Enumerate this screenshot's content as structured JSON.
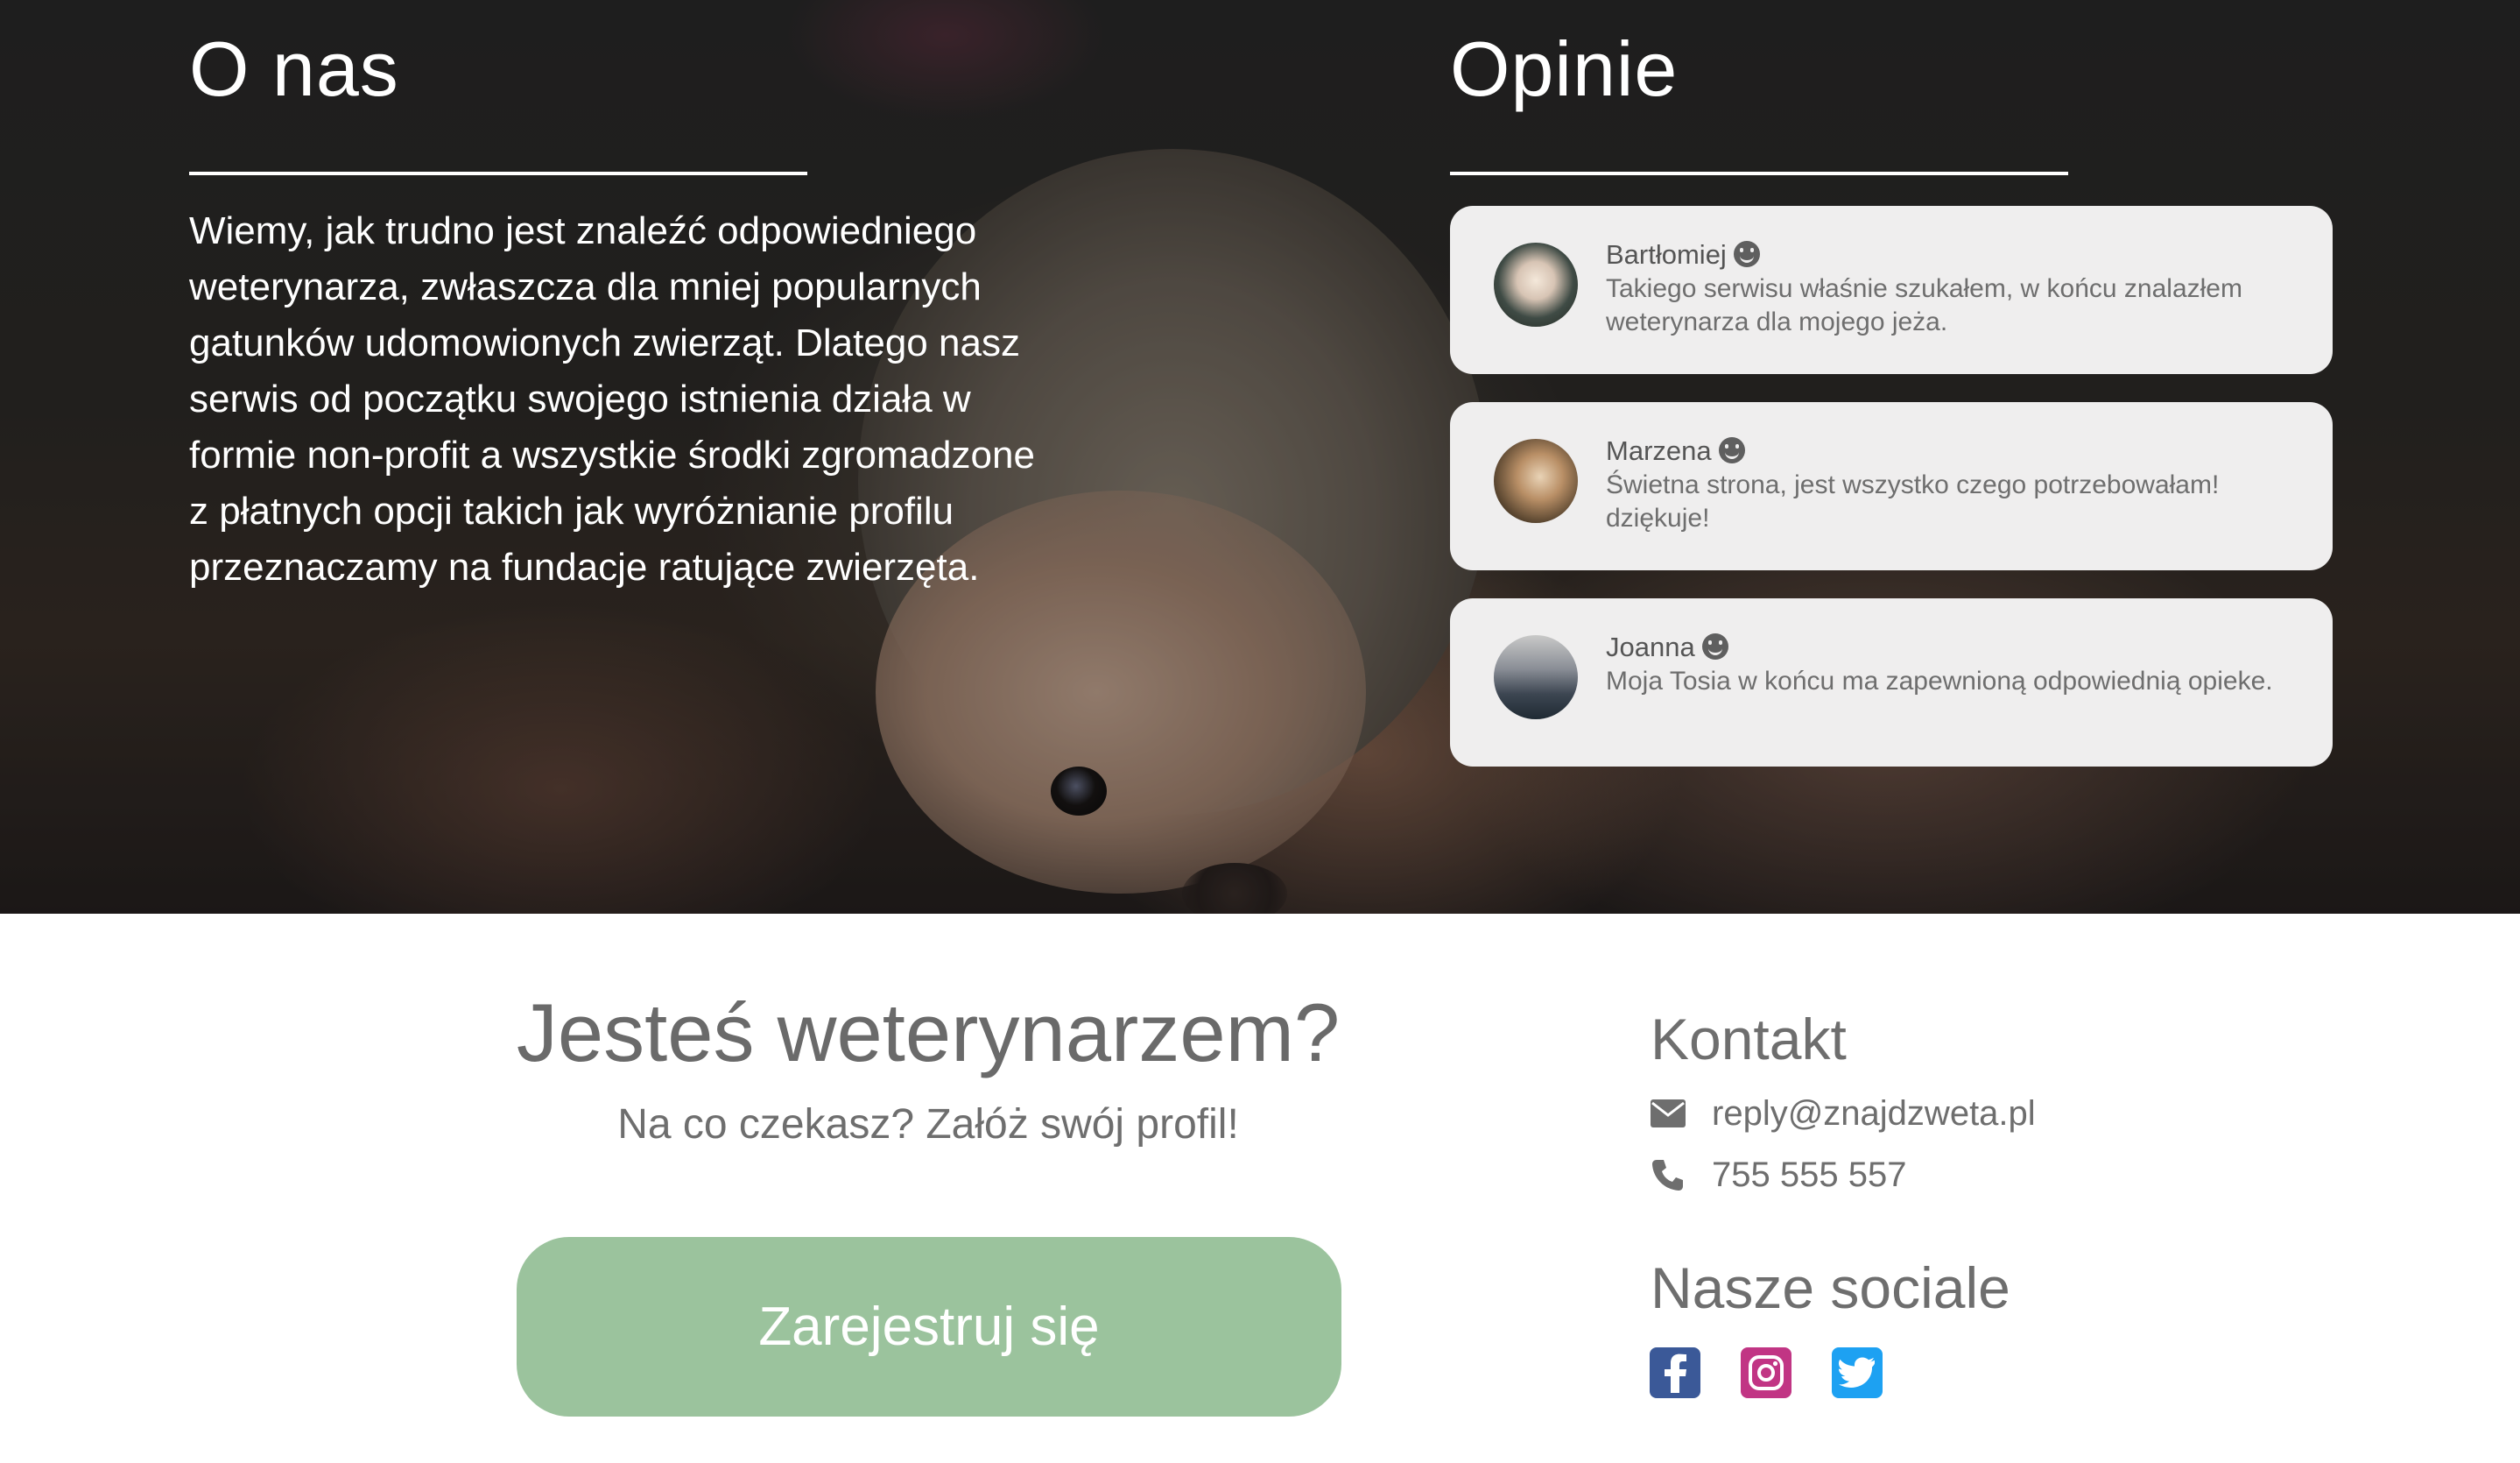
{
  "about": {
    "title": "O nas",
    "text": "Wiemy, jak trudno jest znaleźć odpowiedniego weterynarza, zwłaszcza dla mniej popularnych gatunków udomowionych zwierząt. Dlatego nasz serwis od początku swojego istnienia działa w formie non-profit a wszystkie środki zgromadzone z płatnych opcji takich jak wyróżnianie profilu przeznaczamy na fundacje ratujące zwierzęta."
  },
  "reviews": {
    "title": "Opinie",
    "items": [
      {
        "name": "Bartłomiej",
        "text": "Takiego serwisu właśnie szukałem, w końcu znalazłem weterynarza dla mojego jeża."
      },
      {
        "name": "Marzena",
        "text": "Świetna strona, jest wszystko czego potrzebowałam! dziękuje!"
      },
      {
        "name": "Joanna",
        "text": "Moja Tosia w końcu ma zapewnioną odpowiednią opieke."
      }
    ]
  },
  "vet_cta": {
    "title": "Jesteś weterynarzem?",
    "subtitle": "Na co czekasz? Załóż swój profil!",
    "button_label": "Zarejestruj się"
  },
  "contact": {
    "title": "Kontakt",
    "email": "reply@znajdzweta.pl",
    "phone": "755 555 557",
    "icons": [
      "envelope-icon",
      "phone-icon"
    ]
  },
  "socials": {
    "title": "Nasze sociale",
    "icons": [
      "facebook-icon",
      "instagram-icon",
      "twitter-icon"
    ]
  },
  "colors": {
    "button": "#9bc39d",
    "facebook": "#3b5998",
    "instagram": "#c13584",
    "twitter": "#1da1f2"
  }
}
